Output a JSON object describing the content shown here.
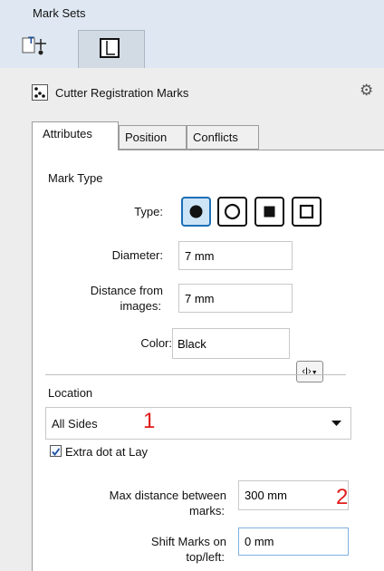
{
  "header": {
    "title": "Mark Sets",
    "tools": [
      {
        "name": "marks-tool",
        "icon": "text-marks-icon"
      },
      {
        "name": "page-tool",
        "icon": "page-icon"
      }
    ]
  },
  "panel": {
    "title": "Cutter Registration Marks",
    "gear_icon": "gear-icon"
  },
  "tabs": [
    {
      "label": "Attributes",
      "active": true
    },
    {
      "label": "Position",
      "active": false
    },
    {
      "label": "Conflicts",
      "active": false
    }
  ],
  "mark_type": {
    "heading": "Mark Type",
    "type_label": "Type:",
    "options": [
      "filled-circle",
      "hollow-circle",
      "filled-square",
      "hollow-square"
    ],
    "selected": "filled-circle",
    "diameter_label": "Diameter:",
    "diameter_value": "7 mm",
    "distance_label_line1": "Distance from",
    "distance_label_line2": "images:",
    "distance_value": "7 mm",
    "color_label": "Color:",
    "color_value": "Black",
    "variable_button": "‹I›"
  },
  "location": {
    "heading": "Location",
    "selected": "All Sides",
    "extra_dot_label": "Extra dot at Lay",
    "extra_dot_checked": true,
    "max_distance_label_line1": "Max distance between",
    "max_distance_label_line2": "marks:",
    "max_distance_value": "300 mm",
    "shift_label_line1": "Shift Marks on",
    "shift_label_line2": "top/left:",
    "shift_value": "0 mm"
  },
  "annotations": [
    "1",
    "2"
  ],
  "colors": {
    "header_bg": "#dfe8f2",
    "selected_type_bg": "#cde4f7",
    "annotation": "#e21b1b"
  }
}
